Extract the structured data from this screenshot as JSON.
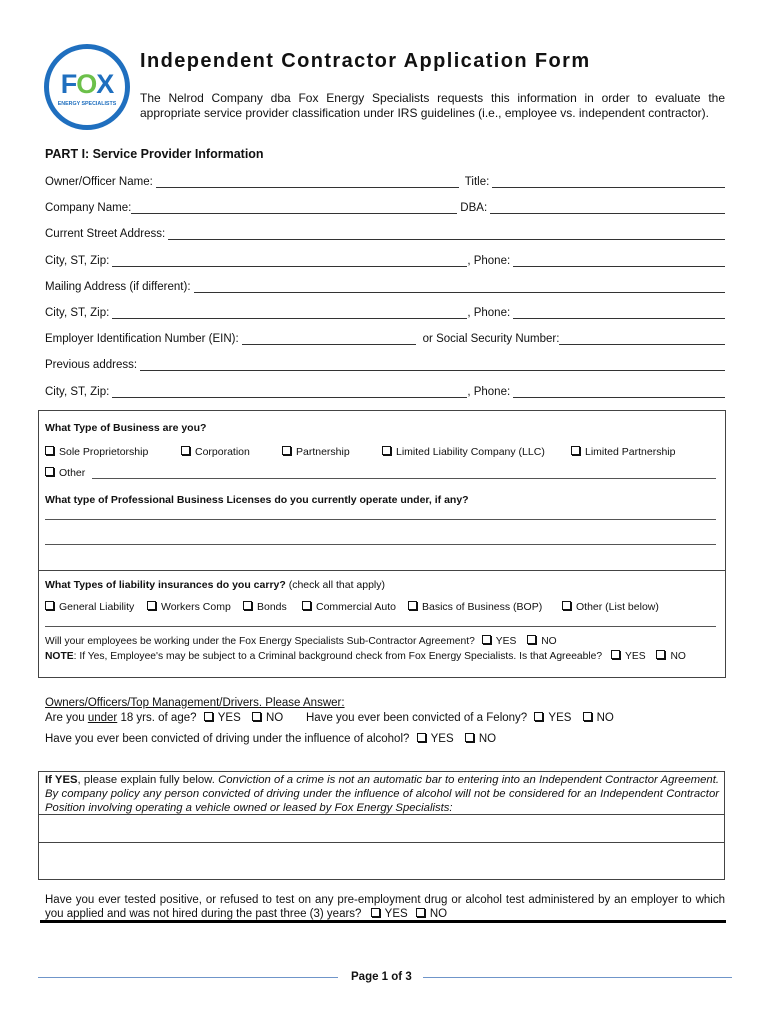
{
  "logo": {
    "brand": "FOX",
    "subtitle": "ENERGY SPECIALISTS",
    "colors": {
      "blue": "#1f6fbf",
      "green": "#6cc04a"
    }
  },
  "header": {
    "title": "Independent Contractor Application Form",
    "intro": "The Nelrod Company dba Fox Energy Specialists requests this information in order to evaluate the appropriate service provider classification under IRS guidelines (i.e., employee vs. independent contractor)."
  },
  "part1": {
    "heading": "PART I:  Service Provider Information",
    "fields": {
      "owner_name": "Owner/Officer Name:",
      "title": "Title:",
      "company_name": "Company Name:",
      "dba": "DBA:",
      "street": "Current Street Address:",
      "city1": "City, ST, Zip:",
      "phone1": ", Phone:",
      "mailing": "Mailing Address (if different):",
      "city2": "City, ST, Zip:",
      "phone2": ", Phone:",
      "ein": "Employer Identification Number (EIN):",
      "ssn": "or Social Security Number:",
      "previous": "Previous address:",
      "city3": "City, ST, Zip:",
      "phone3": ", Phone:"
    }
  },
  "business_type": {
    "question": "What Type of Business are you?",
    "options": [
      "Sole Proprietorship",
      "Corporation",
      "Partnership",
      "Limited Liability Company (LLC)",
      "Limited Partnership"
    ],
    "other": "Other"
  },
  "licenses": {
    "question": "What type of Professional Business Licenses do you currently operate under, if any?"
  },
  "insurance": {
    "question": "What Types of liability insurances do you carry?",
    "hint": "(check all that apply)",
    "options": [
      "General Liability",
      "Workers Comp",
      "Bonds",
      "Commercial Auto",
      "Basics of Business (BOP)",
      "Other (List below)"
    ],
    "subcontract_q": "Will your employees be working under the Fox Energy Specialists Sub-Contractor Agreement?",
    "note_label": "NOTE",
    "note_text": ":  If Yes, Employee's may be subject to a Criminal background check from Fox Energy Specialists. Is that Agreeable?",
    "yes": "YES",
    "no": "NO"
  },
  "owners": {
    "heading": "Owners/Officers/Top Management/Drivers.  Please Answer:",
    "q_age_pre": "Are you ",
    "q_age_under": "under",
    "q_age_post": " 18 yrs. of age?",
    "q_felony": "Have you ever been convicted of a Felony?",
    "q_dui": "Have you ever been convicted of driving under the influence of alcohol?",
    "yes": "YES",
    "no": "NO"
  },
  "explain": {
    "if_yes": "If YES",
    "plain": ", please explain fully below. ",
    "italic": "Conviction of a crime is not an automatic bar to entering into an Independent Contractor Agreement. By company policy any person convicted of driving under the influence of alcohol will not be considered for an Independent Contractor Position involving operating a vehicle owned or leased by Fox Energy Specialists:"
  },
  "drug_test": {
    "question": "Have you ever tested positive, or refused to test on any pre-employment drug or alcohol test administered by an employer to which you applied and was not hired during the past three (3) years?",
    "yes": "YES",
    "no": "NO"
  },
  "footer": {
    "page": "Page 1 of 3"
  }
}
